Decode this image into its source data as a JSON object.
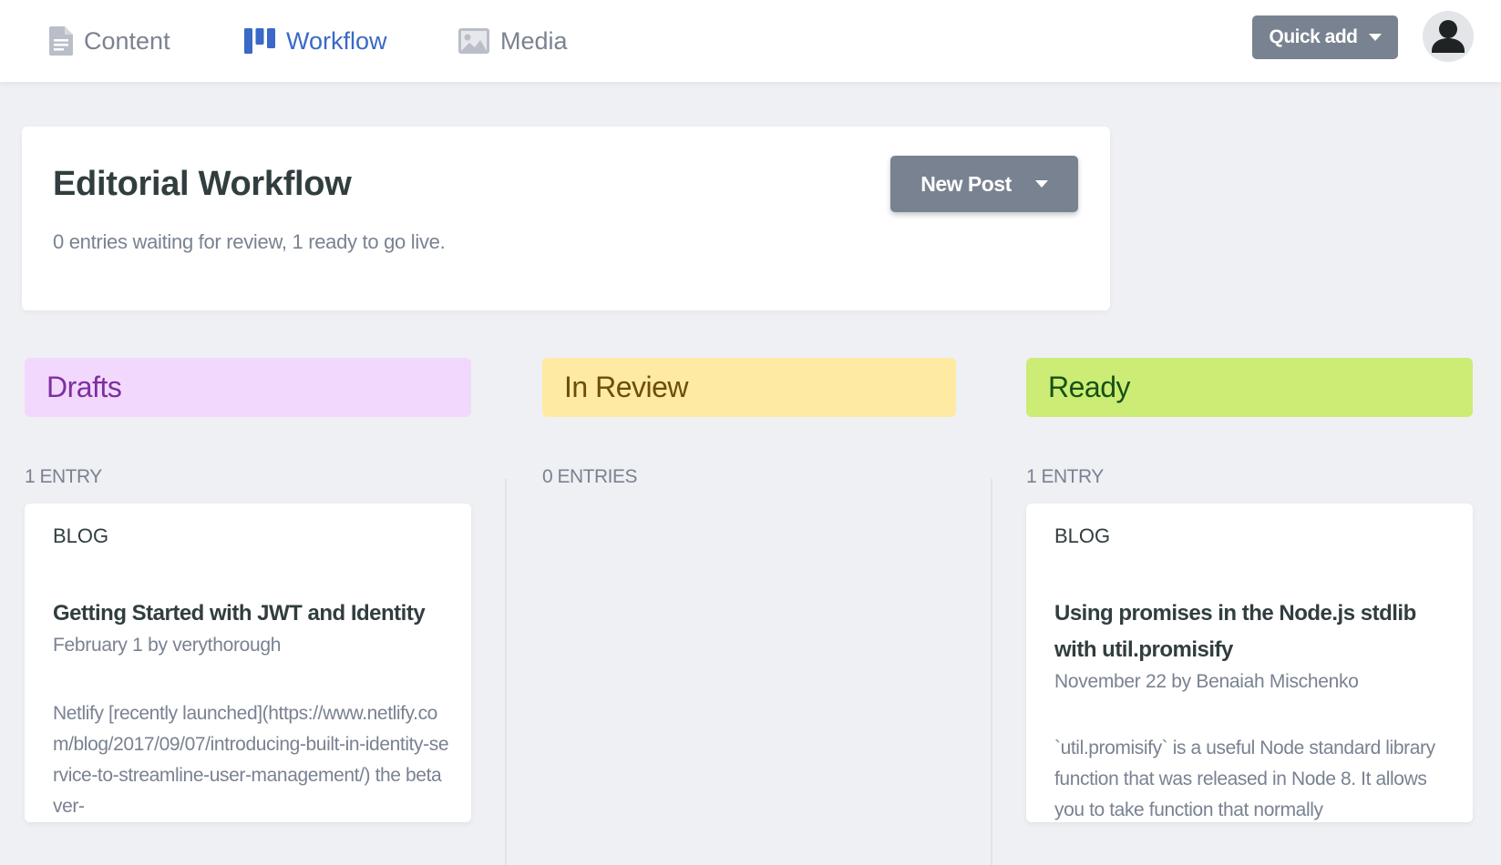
{
  "nav": {
    "content": "Content",
    "workflow": "Workflow",
    "media": "Media",
    "quick_add": "Quick add"
  },
  "header": {
    "title": "Editorial Workflow",
    "subtitle": "0 entries waiting for review, 1 ready to go live.",
    "new_post": "New Post"
  },
  "columns": [
    {
      "label": "Drafts",
      "count": "1 ENTRY",
      "color_bg": "#f2d8fd",
      "color_text": "#7e2fa0",
      "entries": [
        {
          "collection": "BLOG",
          "title": "Getting Started with JWT and Identity",
          "meta": "February 1 by verythorough",
          "excerpt": "Netlify [recently launched](https://www.netlify.com/blog/2017/09/07/introducing-built-in-identity-service-to-streamline-user-management/) the beta ver-"
        }
      ]
    },
    {
      "label": "In Review",
      "count": "0 ENTRIES",
      "color_bg": "#feeaa2",
      "color_text": "#6d4d08",
      "entries": []
    },
    {
      "label": "Ready",
      "count": "1 ENTRY",
      "color_bg": "#ccec76",
      "color_text": "#175212",
      "entries": [
        {
          "collection": "BLOG",
          "title": "Using promises in the Node.js stdlib with util.promisify",
          "meta": "November 22 by Benaiah Mischenko",
          "excerpt": "`util.promisify` is a useful Node standard library function that was released in Node 8. It allows you to take function that normally"
        }
      ]
    }
  ],
  "colors": {
    "accent": "#3a69c7",
    "button": "#798291",
    "background": "#eff0f4"
  },
  "icons": {
    "content": "document-icon",
    "workflow": "kanban-icon",
    "media": "image-icon",
    "avatar": "user-icon"
  }
}
